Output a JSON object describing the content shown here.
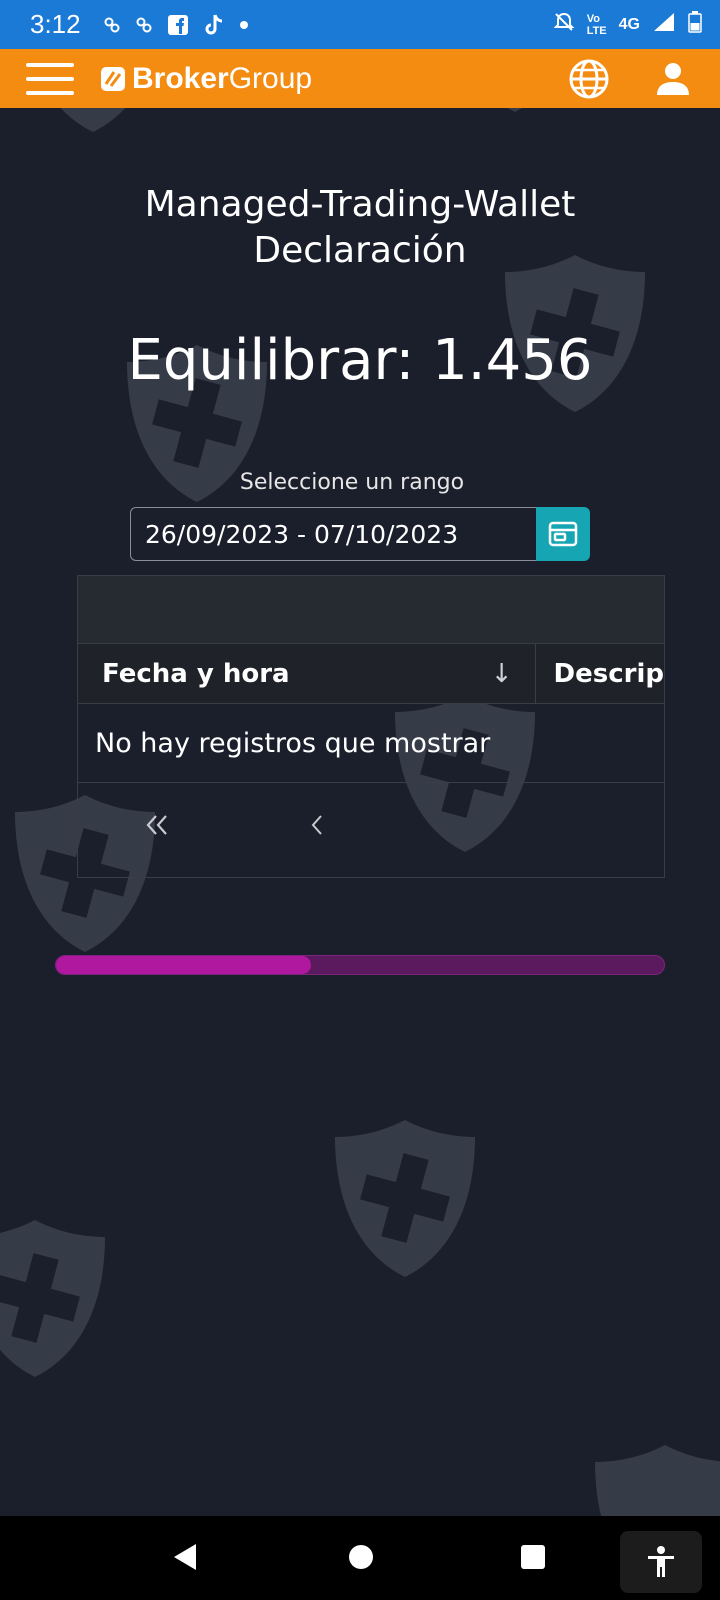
{
  "status_bar": {
    "time": "3:12",
    "network_top": "Vo",
    "network_bottom": "LTE",
    "signal_label": "4G"
  },
  "header": {
    "brand_bold": "Broker",
    "brand_light": "Group",
    "accent_color": "#f58c12"
  },
  "page": {
    "title_line1": "Managed-Trading-Wallet",
    "title_line2": "Declaración",
    "balance": "Equilibrar: 1.456",
    "range_label": "Seleccione un rango",
    "date_range_value": "26/09/2023 - 07/10/2023"
  },
  "table": {
    "columns": [
      "Fecha y hora",
      "Descrip"
    ],
    "empty_message": "No hay registros que mostrar"
  },
  "progress": {
    "fraction": 0.42,
    "color": "#b0189f"
  },
  "icons": {
    "menu": "hamburger-icon",
    "language": "globe-icon",
    "account": "user-icon",
    "calendar": "calendar-icon",
    "sort": "arrow-down-icon",
    "first_page": "double-chevron-left-icon",
    "prev_page": "chevron-left-icon"
  }
}
